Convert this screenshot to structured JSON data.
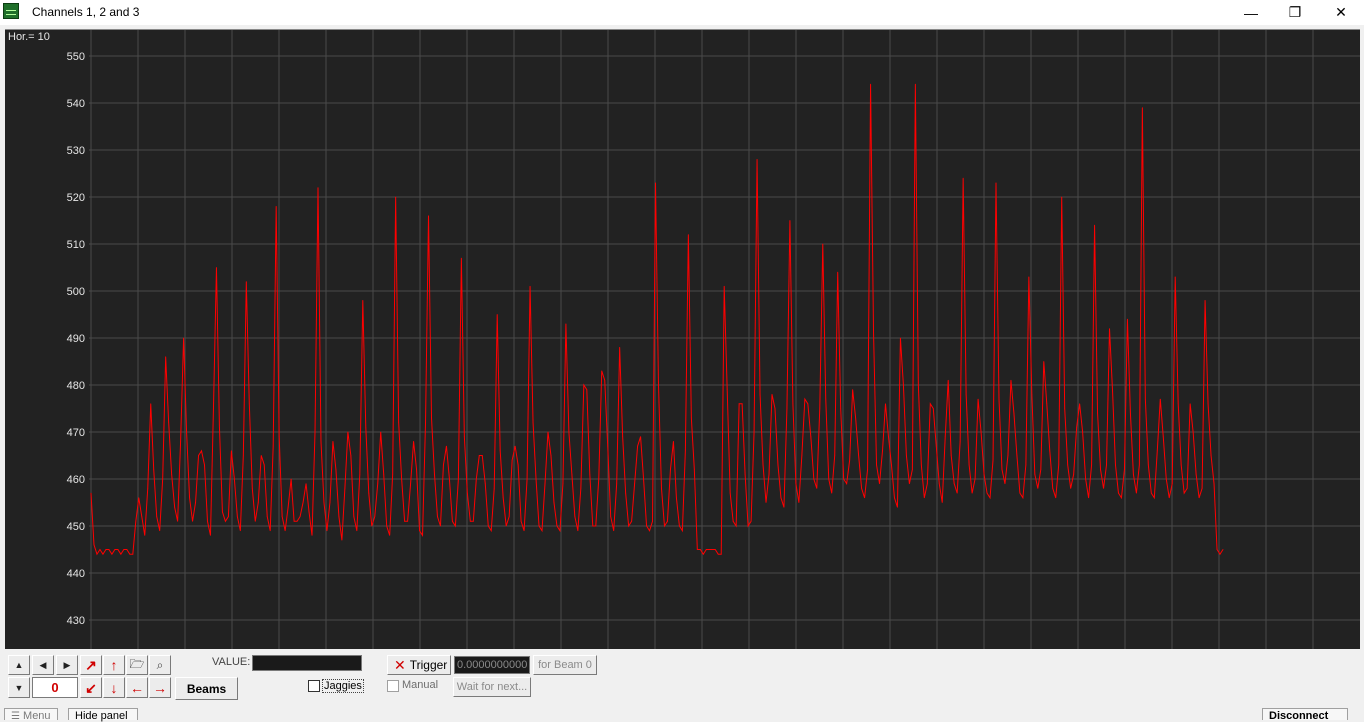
{
  "window": {
    "title": "Channels 1, 2 and 3",
    "minimize": "—",
    "restore": "❐",
    "close": "✕"
  },
  "plot": {
    "hor_label": "Hor.=  10",
    "bg_color": "#222222",
    "grid_color": "#4a4a4a",
    "trace_color": "#ff0000",
    "label_color": "#e6e6e6"
  },
  "chart_data": {
    "type": "line",
    "title": "",
    "xlabel": "",
    "ylabel": "",
    "ylim": [
      425,
      555
    ],
    "ytick_labels": [
      "550",
      "540",
      "530",
      "520",
      "510",
      "500",
      "490",
      "480",
      "470",
      "460",
      "450",
      "440",
      "430"
    ],
    "grid": true,
    "series": [
      {
        "values": [
          457,
          446,
          444,
          445,
          444,
          445,
          445,
          444,
          445,
          445,
          444,
          445,
          445,
          444,
          444,
          451,
          456,
          452,
          448,
          458,
          476,
          462,
          452,
          449,
          460,
          486,
          472,
          461,
          454,
          451,
          468,
          490,
          470,
          456,
          451,
          455,
          465,
          466,
          463,
          451,
          448,
          475,
          505,
          471,
          453,
          451,
          452,
          466,
          460,
          452,
          449,
          465,
          502,
          476,
          458,
          451,
          455,
          465,
          463,
          452,
          449,
          467,
          518,
          469,
          452,
          449,
          454,
          460,
          451,
          451,
          452,
          455,
          459,
          453,
          448,
          470,
          522,
          468,
          455,
          449,
          455,
          468,
          462,
          452,
          447,
          458,
          470,
          465,
          452,
          449,
          461,
          498,
          471,
          457,
          450,
          452,
          459,
          470,
          461,
          450,
          448,
          461,
          520,
          472,
          460,
          451,
          451,
          459,
          468,
          462,
          449,
          448,
          472,
          516,
          473,
          461,
          452,
          450,
          463,
          467,
          460,
          451,
          450,
          460,
          507,
          469,
          457,
          451,
          451,
          460,
          465,
          465,
          459,
          450,
          449,
          458,
          495,
          466,
          456,
          450,
          452,
          464,
          467,
          463,
          451,
          449,
          460,
          501,
          472,
          460,
          450,
          449,
          459,
          470,
          465,
          455,
          450,
          449,
          459,
          493,
          470,
          461,
          452,
          449,
          458,
          480,
          479,
          461,
          450,
          450,
          460,
          483,
          481,
          467,
          452,
          449,
          459,
          488,
          469,
          457,
          450,
          451,
          459,
          467,
          469,
          460,
          450,
          449,
          451,
          523,
          480,
          458,
          450,
          451,
          462,
          468,
          456,
          450,
          449,
          466,
          512,
          473,
          462,
          445,
          445,
          444,
          445,
          445,
          445,
          445,
          444,
          444,
          501,
          479,
          457,
          451,
          450,
          476,
          476,
          461,
          450,
          451,
          470,
          528,
          478,
          463,
          455,
          461,
          478,
          475,
          463,
          456,
          454,
          475,
          515,
          476,
          459,
          455,
          465,
          477,
          476,
          469,
          460,
          458,
          475,
          510,
          477,
          460,
          457,
          465,
          504,
          475,
          460,
          459,
          464,
          479,
          473,
          465,
          458,
          456,
          462,
          544,
          491,
          463,
          459,
          466,
          476,
          469,
          463,
          456,
          454,
          490,
          480,
          465,
          459,
          462,
          544,
          480,
          463,
          456,
          459,
          476,
          475,
          467,
          459,
          455,
          469,
          481,
          465,
          459,
          457,
          468,
          524,
          478,
          463,
          457,
          460,
          477,
          470,
          461,
          457,
          456,
          464,
          523,
          477,
          462,
          459,
          465,
          481,
          474,
          465,
          457,
          456,
          463,
          503,
          478,
          461,
          458,
          462,
          485,
          476,
          466,
          458,
          456,
          463,
          520,
          475,
          463,
          458,
          461,
          471,
          476,
          470,
          460,
          456,
          463,
          514,
          474,
          462,
          458,
          463,
          492,
          479,
          463,
          457,
          456,
          462,
          494,
          474,
          461,
          457,
          463,
          539,
          477,
          463,
          457,
          456,
          466,
          477,
          469,
          460,
          456,
          459,
          503,
          476,
          463,
          457,
          458,
          476,
          470,
          461,
          456,
          458,
          498,
          476,
          465,
          459,
          445,
          444,
          445
        ]
      }
    ]
  },
  "controls": {
    "value_label": "VALUE:",
    "beam_counter": "0",
    "beams_button": "Beams",
    "jaggies_label": "Jaggies",
    "trigger_label": "Trigger",
    "trigger_value": "0.0000000000",
    "for_beam": "for Beam 0",
    "manual_label": "Manual",
    "wait_label": "Wait for next..."
  },
  "bottom": {
    "menu": "Menu",
    "hide_panel": "Hide panel",
    "disconnect": "Disconnect"
  }
}
